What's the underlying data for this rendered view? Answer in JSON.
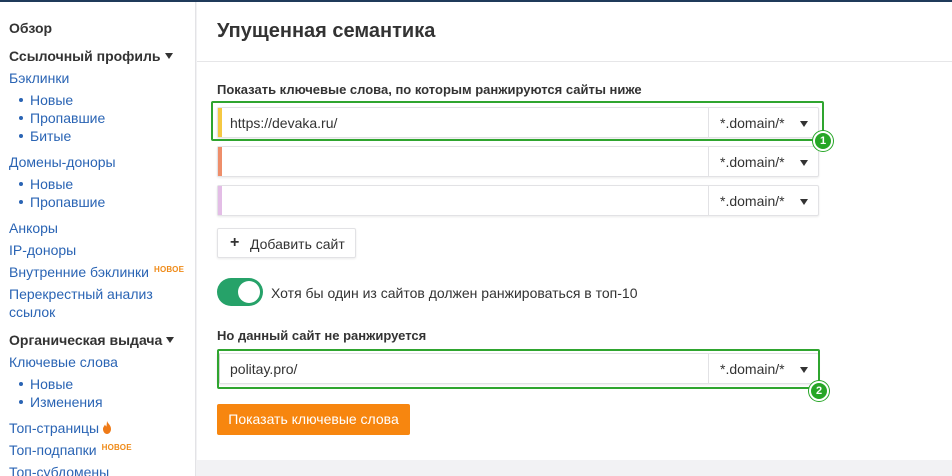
{
  "sidebar": {
    "overview": "Обзор",
    "link_profile": {
      "heading": "Ссылочный профиль",
      "backlinks": "Бэклинки",
      "backlinks_sub": [
        "Новые",
        "Пропавшие",
        "Битые"
      ],
      "referring_domains": "Домены-доноры",
      "referring_domains_sub": [
        "Новые",
        "Пропавшие"
      ],
      "anchors": "Анкоры",
      "ip_donors": "IP-доноры",
      "internal_backlinks": "Внутренние бэклинки",
      "internal_badge": "НОВОЕ",
      "cross_analysis_line1": "Перекрестный анализ",
      "cross_analysis_line2": "ссылок"
    },
    "organic": {
      "heading": "Органическая выдача",
      "keywords": "Ключевые слова",
      "keywords_sub": [
        "Новые",
        "Изменения"
      ],
      "top_pages": "Топ-страницы",
      "top_folders": "Топ-подпапки",
      "top_folders_badge": "НОВОЕ",
      "top_subdomains": "Топ-субдомены"
    }
  },
  "header": {
    "title": "Упущенная семантика"
  },
  "form": {
    "show_label": "Показать ключевые слова, по которым ранжируются сайты ниже",
    "sites": [
      {
        "value": "https://devaka.ru/",
        "mode": "*.domain/*",
        "stripe_color": "#f5c842"
      },
      {
        "value": "",
        "mode": "*.domain/*",
        "stripe_color": "#ee8e6a"
      },
      {
        "value": "",
        "mode": "*.domain/*",
        "stripe_color": "#e3bde6"
      }
    ],
    "add_site": "Добавить сайт",
    "toggle_label": "Хотя бы один из сайтов должен ранжироваться в топ-10",
    "toggle_on": true,
    "exclude_label": "Но данный сайт не ранжируется",
    "exclude_site": {
      "value": "politay.pro/",
      "mode": "*.domain/*",
      "stripe_color": "#cfcfcf"
    },
    "submit": "Показать ключевые слова"
  },
  "annotations": {
    "marker1": "1",
    "marker2": "2"
  },
  "colors": {
    "accent": "#f7860f",
    "link": "#2a64b4",
    "toggle": "#26a269",
    "highlight": "#2fa52f",
    "badge": "#ef8a17"
  }
}
